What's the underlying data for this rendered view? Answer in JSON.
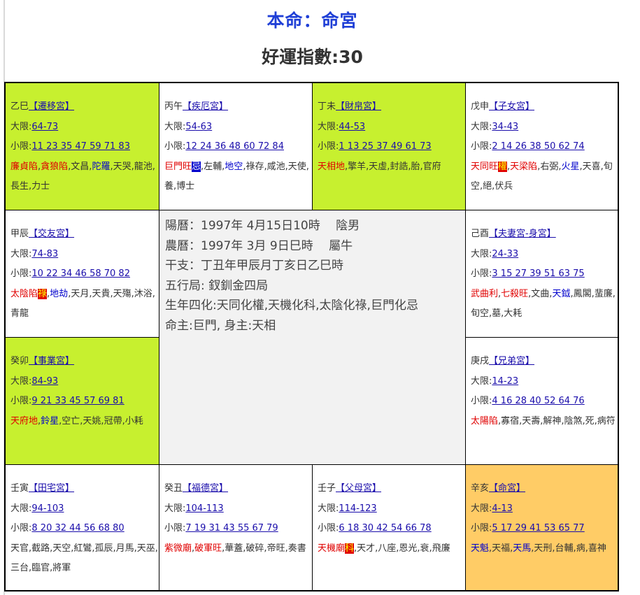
{
  "header": {
    "title": "本命：命宮",
    "score": "好運指數:30"
  },
  "center": {
    "lines": [
      "陽曆：1997年 4月15日10時　 陰男",
      "農曆：1997年 3月 9日巳時　 屬牛",
      "干支：丁丑年甲辰月丁亥日乙巳時",
      "五行局: 釵釧金四局",
      "生年四化:天同化權,天機化科,太陰化祿,巨門化忌",
      "命主:巨門, 身主:天相"
    ]
  },
  "palaces": {
    "qianyi": {
      "stem_branch": "乙巳",
      "name": "【遷移宮】",
      "daxian_label": "大限:",
      "daxian": "64-73",
      "xiaoxian_label": "小限:",
      "xiaoxian": "11 23 35 47 59 71 83",
      "s1": "廉貞陷",
      "sep1": ",",
      "s2": "貪狼陷",
      "s3": ",文昌,",
      "s4": "陀羅",
      "s5": ",天哭,龍池,長生,力士"
    },
    "jie": {
      "stem_branch": "丙午",
      "name": "【疾厄宮】",
      "daxian_label": "大限:",
      "daxian": "54-63",
      "xiaoxian_label": "小限:",
      "xiaoxian": "12 24 36 48 60 72 84",
      "s1": "巨門旺",
      "s2": "忌",
      "s3": ",左輔,",
      "s4": "地空",
      "s5": ",祿存,咸池,天使,養,博士"
    },
    "caibo": {
      "stem_branch": "丁未",
      "name": "【財帛宮】",
      "daxian_label": "大限:",
      "daxian": "44-53",
      "xiaoxian_label": "小限:",
      "xiaoxian": "1 13 25 37 49 61 73",
      "s1": "天相地",
      "s2": ",擎羊,天虛,封誥,胎,官府"
    },
    "zinv": {
      "stem_branch": "戊申",
      "name": "【子女宮】",
      "daxian_label": "大限:",
      "daxian": "34-43",
      "xiaoxian_label": "小限:",
      "xiaoxian": "2 14 26 38 50 62 74",
      "s1": "天同旺",
      "s2": "權",
      "sep1": ",",
      "s3": "天梁陷",
      "s4": ",右弼,",
      "s5": "火星",
      "s6": ",天喜,旬空,絕,伏兵"
    },
    "jiaoyou": {
      "stem_branch": "甲辰",
      "name": "【交友宮】",
      "daxian_label": "大限:",
      "daxian": "74-83",
      "xiaoxian_label": "小限:",
      "xiaoxian": "10 22 34 46 58 70 82",
      "s1": "太陰陷",
      "s2": "祿",
      "s3": ",",
      "s4": "地劫",
      "s5": ",天月,天貴,天殤,沐浴,青龍"
    },
    "fuqi": {
      "stem_branch": "己酉",
      "name": "【夫妻宮-身宮】",
      "daxian_label": "大限:",
      "daxian": "24-33",
      "xiaoxian_label": "小限:",
      "xiaoxian": "3 15 27 39 51 63 75",
      "s1": "武曲利",
      "sep1": ",",
      "s2": "七殺旺",
      "s3": ",文曲,",
      "s4": "天鉞",
      "s5": ",鳳閣,蜚廉,旬空,墓,大耗"
    },
    "shiye": {
      "stem_branch": "癸卯",
      "name": "【事業宮】",
      "daxian_label": "大限:",
      "daxian": "84-93",
      "xiaoxian_label": "小限:",
      "xiaoxian": "9 21 33 45 57 69 81",
      "s1": "天府地",
      "s2": ",",
      "s3": "鈴星",
      "s4": ",空亡,天姚,冠帶,小耗"
    },
    "xiongdi": {
      "stem_branch": "庚戌",
      "name": "【兄弟宮】",
      "daxian_label": "大限:",
      "daxian": "14-23",
      "xiaoxian_label": "小限:",
      "xiaoxian": "4 16 28 40 52 64 76",
      "s1": "太陽陷",
      "s2": ",寡宿,天壽,解神,陰煞,死,病符"
    },
    "tianzhai": {
      "stem_branch": "壬寅",
      "name": "【田宅宮】",
      "daxian_label": "大限:",
      "daxian": "94-103",
      "xiaoxian_label": "小限:",
      "xiaoxian": "8 20 32 44 56 68 80",
      "s1": "天官,截路,天空,紅鸞,孤辰,月馬,天巫,三台,臨官,將軍"
    },
    "fude": {
      "stem_branch": "癸丑",
      "name": "【福德宮】",
      "daxian_label": "大限:",
      "daxian": "104-113",
      "xiaoxian_label": "小限:",
      "xiaoxian": "7 19 31 43 55 67 79",
      "s1": "紫微廟",
      "sep1": ",",
      "s2": "破軍旺",
      "s3": ",華蓋,破碎,帝旺,奏書"
    },
    "fumu": {
      "stem_branch": "壬子",
      "name": "【父母宮】",
      "daxian_label": "大限:",
      "daxian": "114-123",
      "xiaoxian_label": "小限:",
      "xiaoxian": "6 18 30 42 54 66 78",
      "s1": "天機廟",
      "s2": "科",
      "s3": ",天才,八座,恩光,衰,飛廉"
    },
    "ming": {
      "stem_branch": "辛亥",
      "name": "【命宮】",
      "daxian_label": "大限:",
      "daxian": "4-13",
      "xiaoxian_label": "小限:",
      "xiaoxian": "5 17 29 41 53 65 77",
      "s1": "天魁",
      "s2": ",天福,",
      "s3": "天馬",
      "s4": ",天刑,台輔,病,喜神"
    }
  },
  "colors": {
    "lime": "#c7f02f",
    "orange": "#ffcc66",
    "title_blue": "#1f3fd6",
    "star_red": "#e00000",
    "star_blue": "#0000cc"
  }
}
